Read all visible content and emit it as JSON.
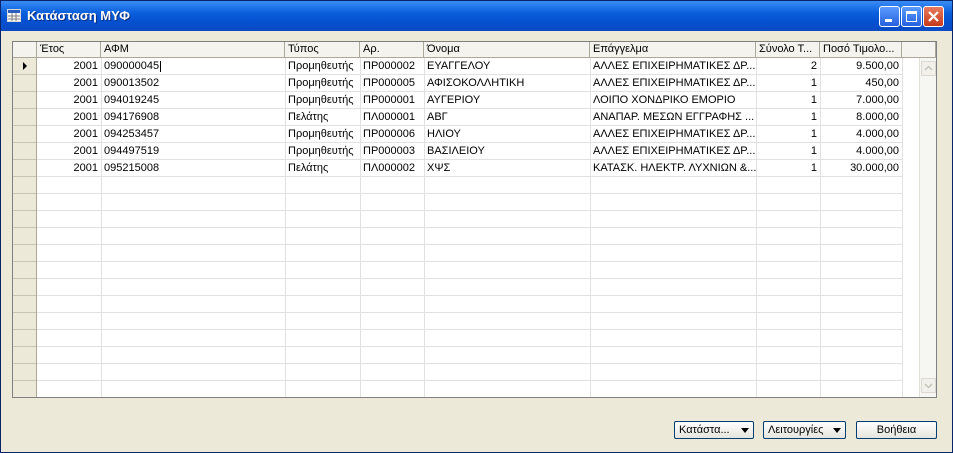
{
  "window": {
    "title": "Κατάσταση ΜΥΦ",
    "title_icon": "table-icon",
    "controls": [
      "minimize-icon",
      "maximize-icon",
      "close-icon"
    ]
  },
  "table": {
    "columns": [
      "Έτος",
      "ΑΦΜ",
      "Τύπος",
      "Αρ.",
      "Όνομα",
      "Επάγγελμα",
      "Σύνολο Τ...",
      "Ποσό Τιμολο..."
    ],
    "rows": [
      [
        "2001",
        "090000045",
        "Προμηθευτής",
        "ΠΡ000002",
        "ΕΥΑΓΓΕΛΟΥ",
        "ΑΛΛΕΣ ΕΠΙΧΕΙΡΗΜΑΤΙΚΕΣ ΔΡ...",
        "2",
        "9.500,00"
      ],
      [
        "2001",
        "090013502",
        "Προμηθευτής",
        "ΠΡ000005",
        "ΑΦΙΣΟΚΟΛΛΗΤΙΚΗ",
        "ΑΛΛΕΣ ΕΠΙΧΕΙΡΗΜΑΤΙΚΕΣ ΔΡ...",
        "1",
        "450,00"
      ],
      [
        "2001",
        "094019245",
        "Προμηθευτής",
        "ΠΡ000001",
        "ΑΥΓΕΡΙΟΥ",
        "ΛΟΙΠΟ ΧΟΝΔΡΙΚΟ ΕΜΟΡΙΟ",
        "1",
        "7.000,00"
      ],
      [
        "2001",
        "094176908",
        "Πελάτης",
        "ΠΛ000001",
        "ΑΒΓ",
        "ΑΝΑΠΑΡ. ΜΕΣΩΝ ΕΓΓΡΑΦΗΣ ...",
        "1",
        "8.000,00"
      ],
      [
        "2001",
        "094253457",
        "Προμηθευτής",
        "ΠΡ000006",
        "ΗΛΙΟΥ",
        "ΑΛΛΕΣ ΕΠΙΧΕΙΡΗΜΑΤΙΚΕΣ ΔΡ...",
        "1",
        "4.000,00"
      ],
      [
        "2001",
        "094497519",
        "Προμηθευτής",
        "ΠΡ000003",
        "ΒΑΣΙΛΕΙΟΥ",
        "ΑΛΛΕΣ ΕΠΙΧΕΙΡΗΜΑΤΙΚΕΣ ΔΡ...",
        "1",
        "4.000,00"
      ],
      [
        "2001",
        "095215008",
        "Πελάτης",
        "ΠΛ000002",
        "ΧΨΣ",
        "ΚΑΤΑΣΚ. ΗΛΕΚΤΡ. ΛΥΧΝΙΩΝ &...",
        "1",
        "30.000,00"
      ]
    ],
    "selected_row": 0
  },
  "footer": {
    "report_button": "Κατάστα...",
    "functions_button": "Λειτουργίες",
    "help_button": "Βοήθεια"
  }
}
